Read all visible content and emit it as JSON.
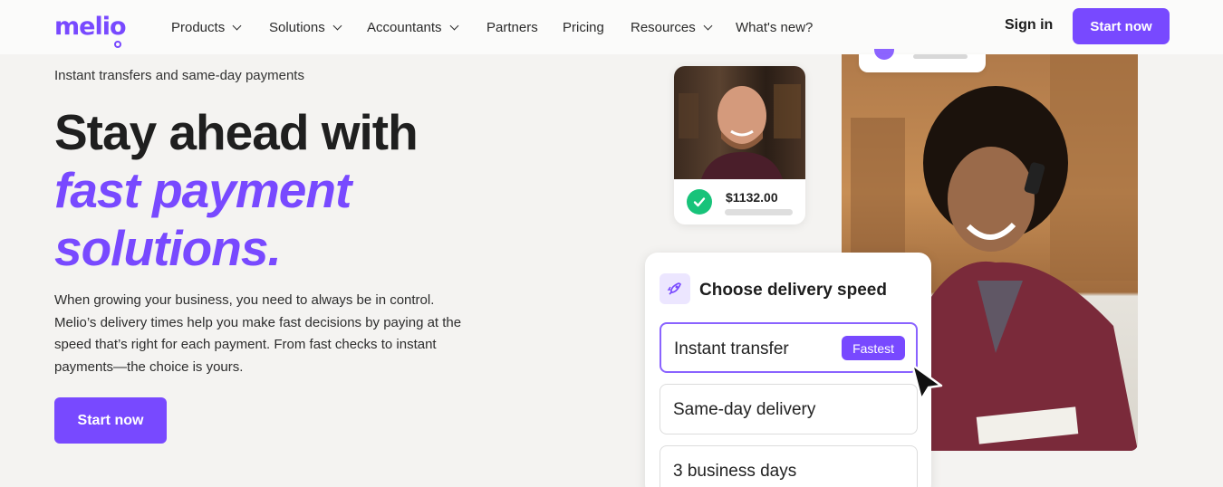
{
  "brand": {
    "logo_text": "melio",
    "accent": "#7849ff"
  },
  "nav": {
    "items": [
      {
        "label": "Products",
        "dropdown": true
      },
      {
        "label": "Solutions",
        "dropdown": true
      },
      {
        "label": "Accountants",
        "dropdown": true
      },
      {
        "label": "Partners",
        "dropdown": false
      },
      {
        "label": "Pricing",
        "dropdown": false
      },
      {
        "label": "Resources",
        "dropdown": true
      },
      {
        "label": "What's new?",
        "dropdown": false
      }
    ],
    "sign_in": "Sign in",
    "cta": "Start now"
  },
  "hero": {
    "eyebrow": "Instant transfers and same-day payments",
    "title_line1": "Stay ahead with",
    "title_accent_line1": "fast payment",
    "title_accent_line2": "solutions.",
    "body": "When growing your business, you need to always be in control. Melio’s delivery times help you make fast decisions by paying at the speed that’s right for each payment. From fast checks to instant payments—the choice is yours.",
    "cta": "Start now"
  },
  "visual": {
    "payment_amount": "$1132.00",
    "delivery_card": {
      "title": "Choose delivery speed",
      "options": [
        {
          "label": "Instant transfer",
          "badge": "Fastest",
          "selected": true
        },
        {
          "label": "Same-day delivery",
          "selected": false
        },
        {
          "label": "3 business days",
          "selected": false
        }
      ]
    }
  }
}
